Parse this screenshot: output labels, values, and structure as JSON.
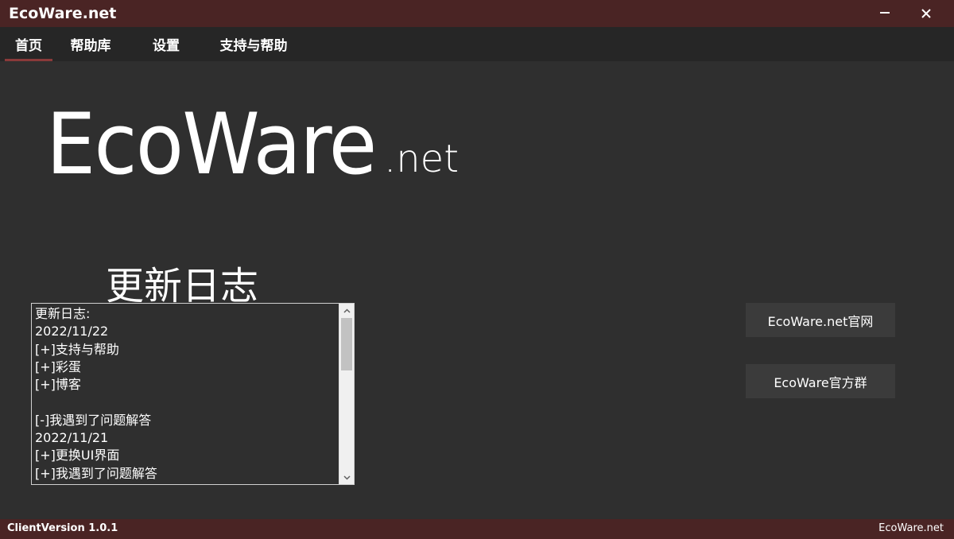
{
  "window": {
    "title": "EcoWare.net",
    "minimize_icon": "minimize-icon",
    "close_icon": "close-icon"
  },
  "tabs": [
    {
      "label": "首页",
      "active": true
    },
    {
      "label": "帮助库",
      "active": false
    },
    {
      "label": "设置",
      "active": false
    },
    {
      "label": "支持与帮助",
      "active": false
    }
  ],
  "logo": {
    "main": "EcoWare",
    "suffix": ".net"
  },
  "changelog": {
    "heading": "更新日志",
    "lines": [
      "更新日志:",
      "2022/11/22",
      "[+]支持与帮助",
      "[+]彩蛋",
      "[+]博客",
      "",
      "[-]我遇到了问题解答",
      "2022/11/21",
      "[+]更换UI界面",
      "[+]我遇到了问题解答"
    ]
  },
  "buttons": {
    "official_site": "EcoWare.net官网",
    "official_group": "EcoWare官方群"
  },
  "status": {
    "client_version": "ClientVersion 1.0.1",
    "site": "EcoWare.net"
  },
  "colors": {
    "titlebar": "#4a2424",
    "background": "#2f2f2f",
    "tabbar": "#262626",
    "active_tab_underline": "#8a3a3a",
    "button": "#3b3b3b"
  }
}
